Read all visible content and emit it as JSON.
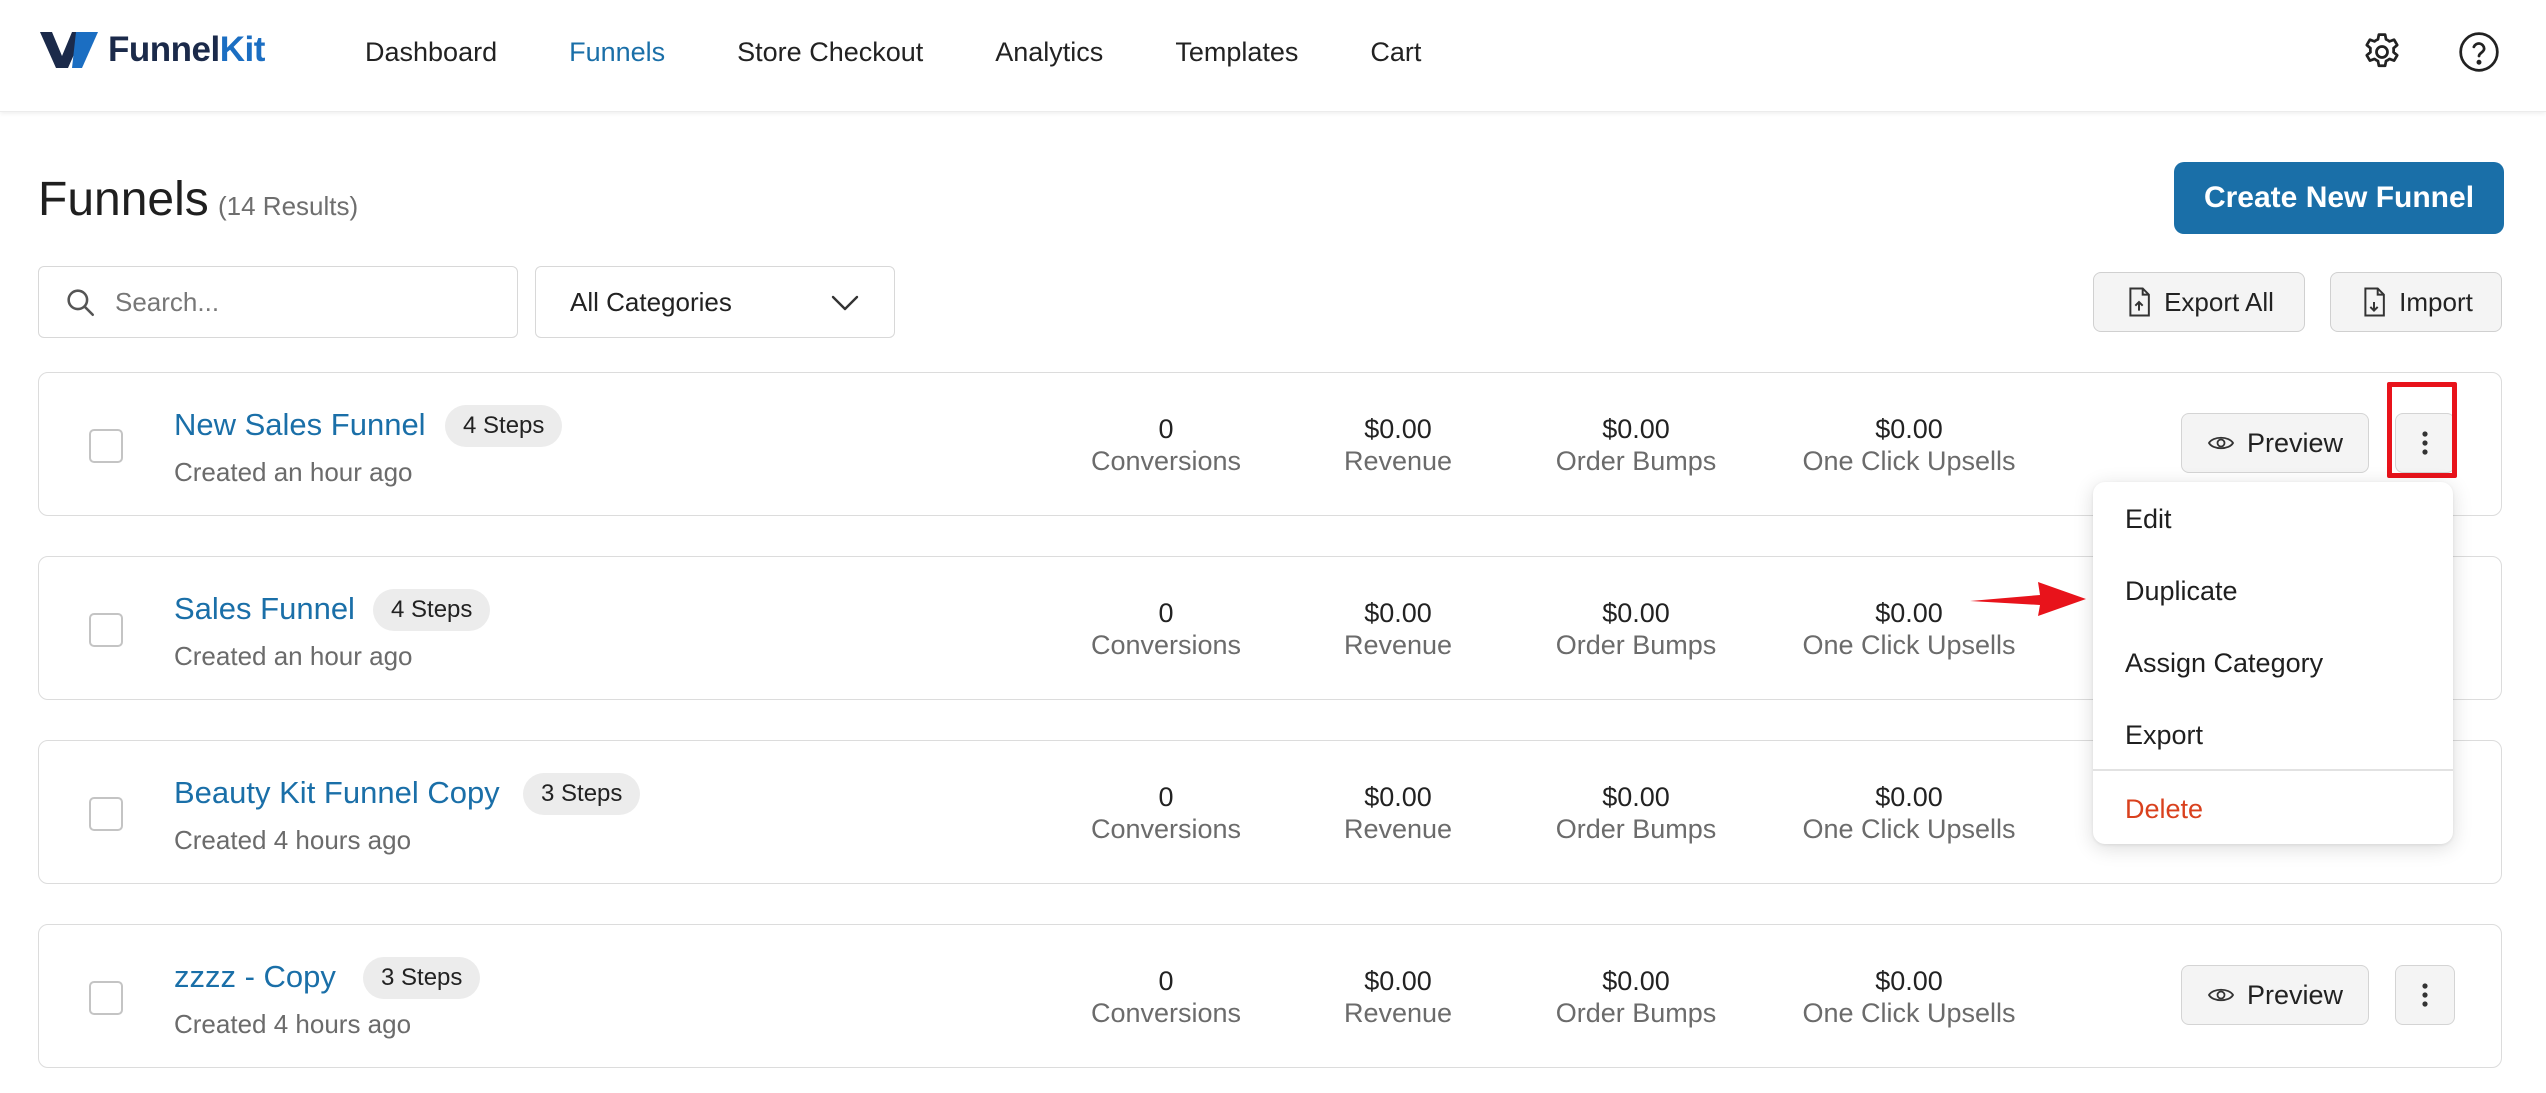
{
  "app": {
    "logo_name": "Funnel",
    "logo_suffix": "Kit",
    "brand_color": "#1a6fa8"
  },
  "nav": {
    "items": [
      {
        "label": "Dashboard",
        "active": false
      },
      {
        "label": "Funnels",
        "active": true
      },
      {
        "label": "Store Checkout",
        "active": false
      },
      {
        "label": "Analytics",
        "active": false
      },
      {
        "label": "Templates",
        "active": false
      },
      {
        "label": "Cart",
        "active": false
      }
    ],
    "icons": [
      "gear-icon",
      "help-icon"
    ]
  },
  "page": {
    "title": "Funnels",
    "count": "(14 Results)",
    "create_label": "Create New Funnel"
  },
  "filters": {
    "search_placeholder": "Search...",
    "category_value": "All Categories",
    "export_label": "Export All",
    "import_label": "Import"
  },
  "stat_labels": {
    "conversions": "Conversions",
    "revenue": "Revenue",
    "order_bumps": "Order Bumps",
    "upsells": "One Click Upsells"
  },
  "preview_label": "Preview",
  "funnels": [
    {
      "name": "New Sales Funnel",
      "steps": "4 Steps",
      "created": "Created an hour ago",
      "conversions": "0",
      "revenue": "$0.00",
      "order_bumps": "$0.00",
      "upsells": "$0.00"
    },
    {
      "name": "Sales Funnel",
      "steps": "4 Steps",
      "created": "Created an hour ago",
      "conversions": "0",
      "revenue": "$0.00",
      "order_bumps": "$0.00",
      "upsells": "$0.00"
    },
    {
      "name": "Beauty Kit Funnel Copy",
      "steps": "3 Steps",
      "created": "Created 4 hours ago",
      "conversions": "0",
      "revenue": "$0.00",
      "order_bumps": "$0.00",
      "upsells": "$0.00"
    },
    {
      "name": "zzzz - Copy",
      "steps": "3 Steps",
      "created": "Created 4 hours ago",
      "conversions": "0",
      "revenue": "$0.00",
      "order_bumps": "$0.00",
      "upsells": "$0.00"
    }
  ],
  "menu": {
    "items": [
      "Edit",
      "Duplicate",
      "Assign Category",
      "Export"
    ],
    "danger_item": "Delete",
    "danger_color": "#d9411e"
  },
  "annotations": {
    "highlight_color": "#e8131b"
  }
}
